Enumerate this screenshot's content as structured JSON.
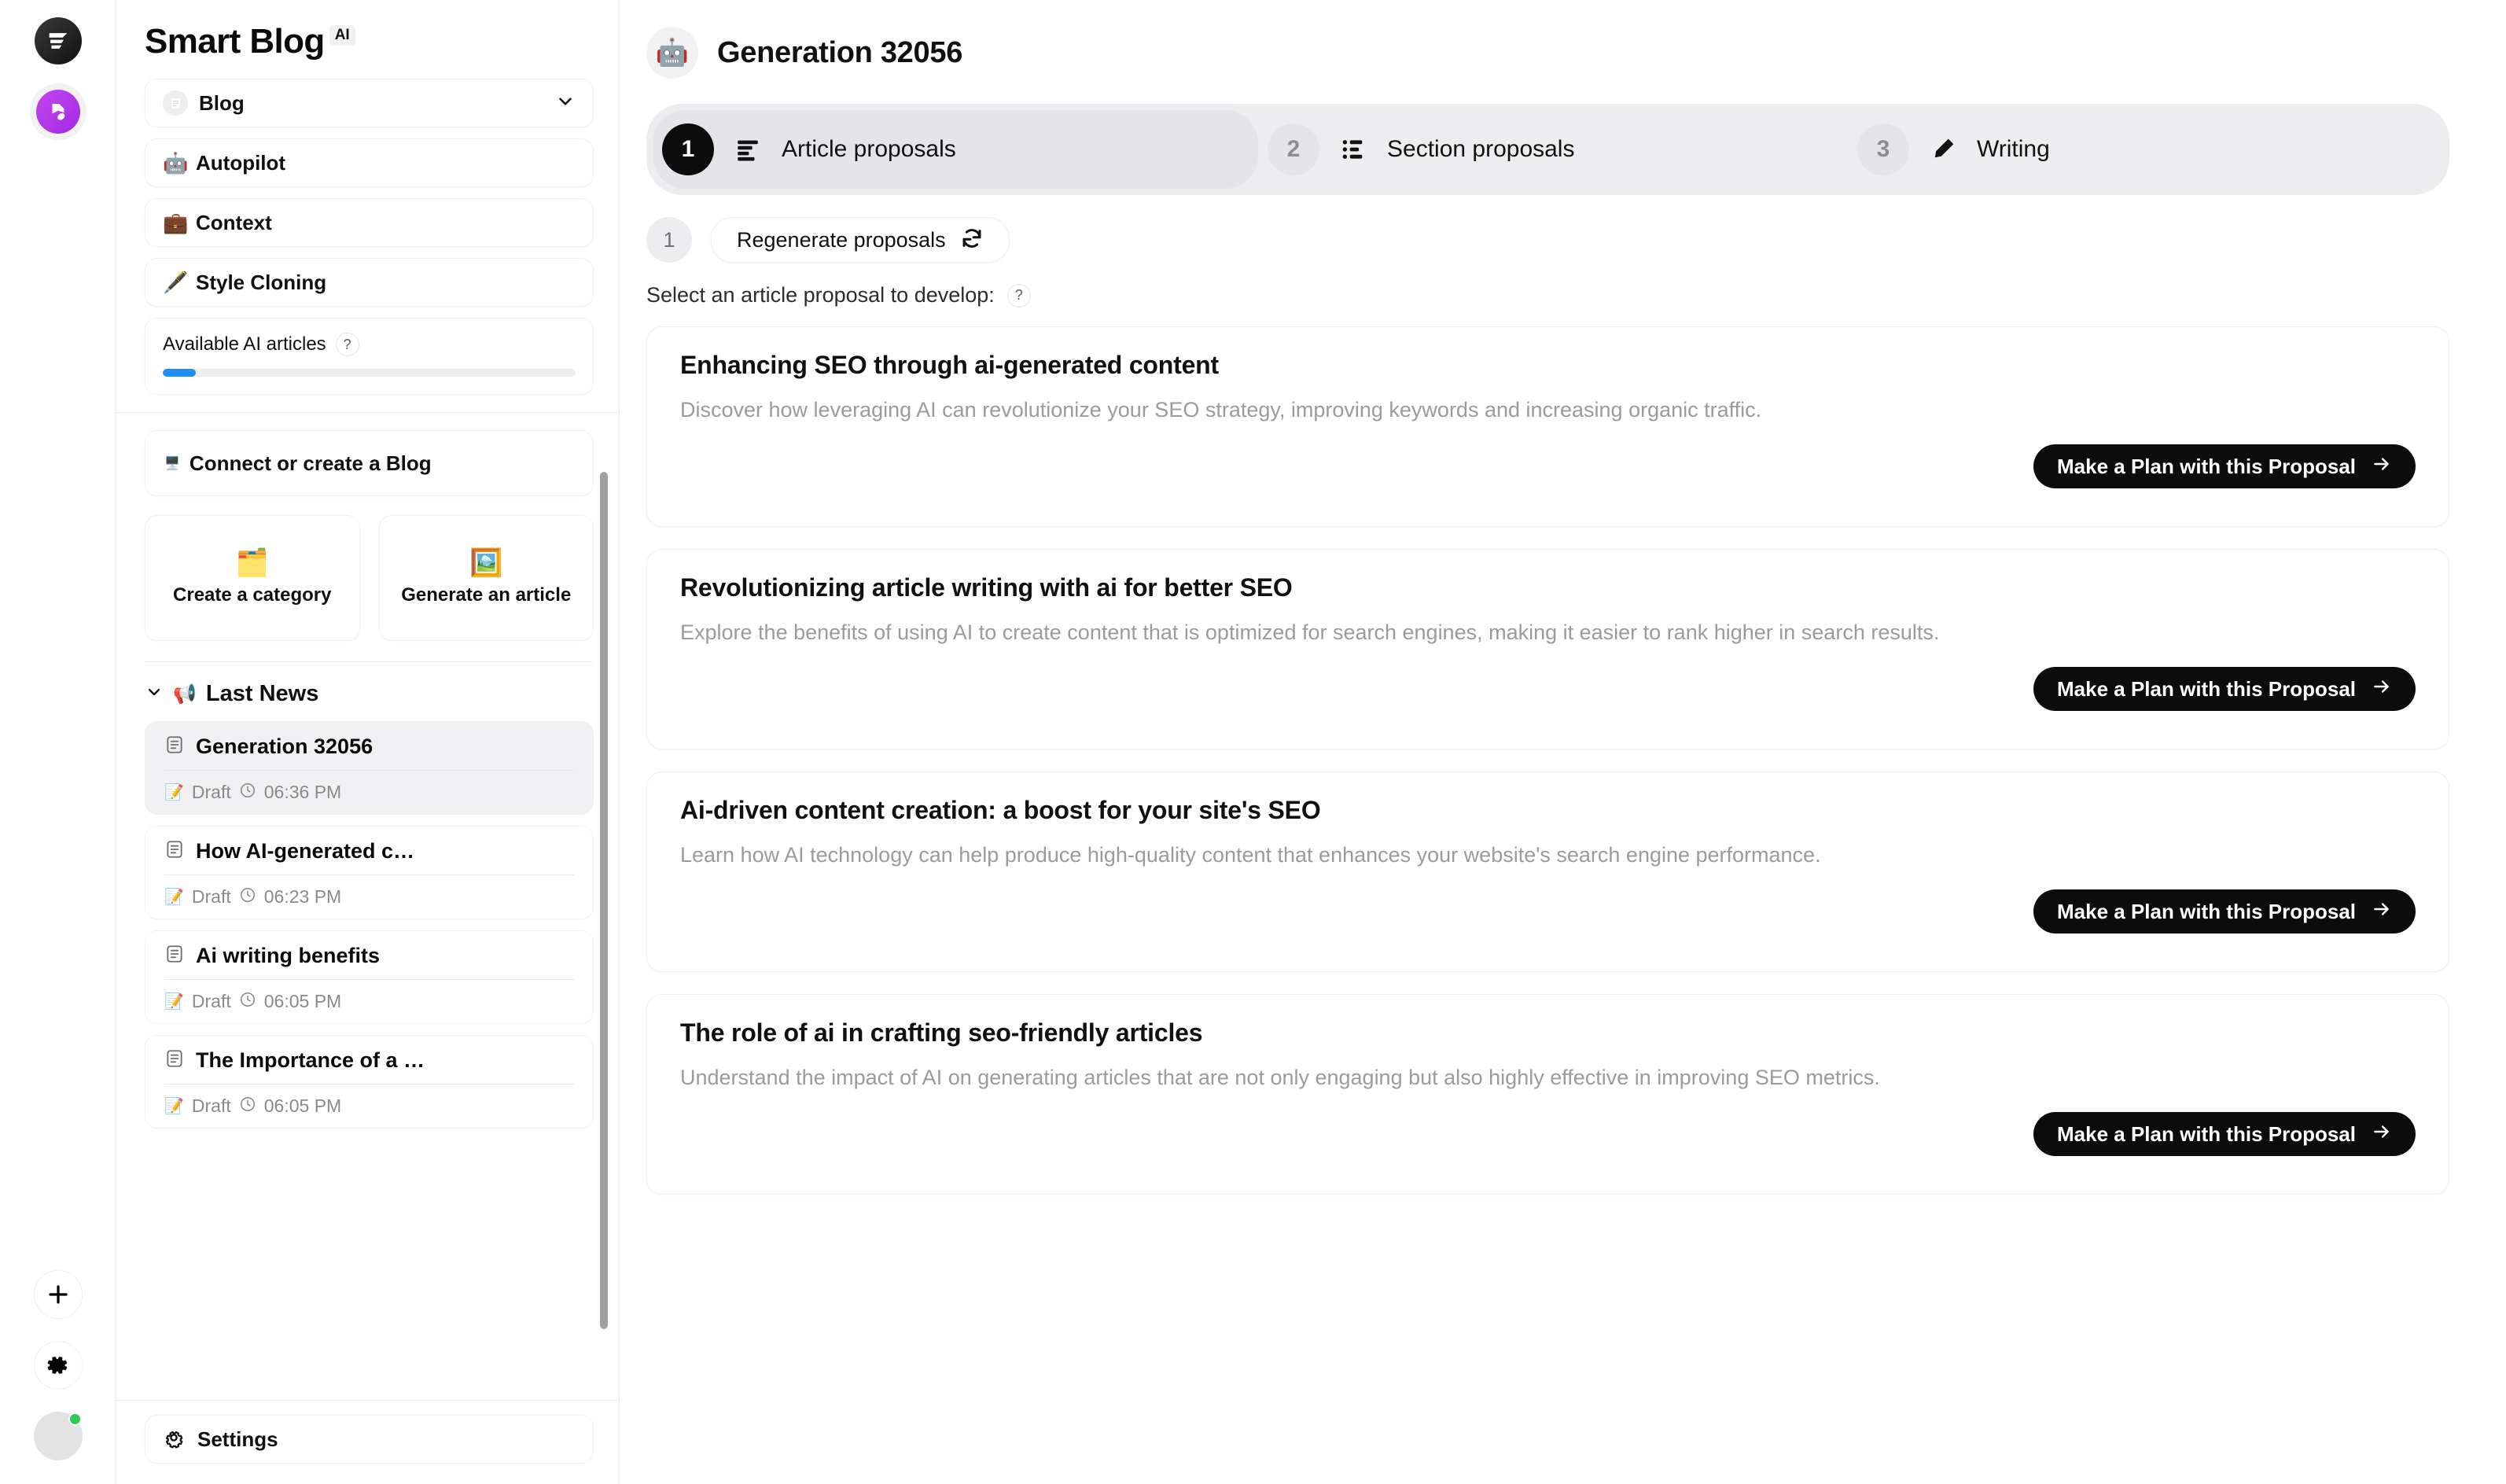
{
  "rail": {
    "logo_icon": "funnel-logo-icon",
    "avatar_icon": "workspace-avatar-icon",
    "add_label": "+",
    "gear_icon": "gear-icon",
    "user_status": "online"
  },
  "sidebar": {
    "title": "Smart Blog",
    "ai_badge": "AI",
    "nav": [
      {
        "label": "Blog",
        "icon": "document-circle-icon",
        "has_chevron": true
      },
      {
        "label": "Autopilot",
        "icon": "robot-emoji",
        "emoji": "🤖"
      },
      {
        "label": "Context",
        "icon": "briefcase-emoji",
        "emoji": "💼"
      },
      {
        "label": "Style Cloning",
        "icon": "fountain-pen-emoji",
        "emoji": "🖋️"
      }
    ],
    "quota": {
      "label": "Available AI articles",
      "help": "?",
      "percent": 8,
      "fill_color": "#1e90f5",
      "track_color": "#eeeeee"
    },
    "connect": {
      "label": "Connect or create a Blog",
      "emoji": "🖥️"
    },
    "tiles": [
      {
        "label": "Create a category",
        "emoji": "🗂️"
      },
      {
        "label": "Generate an article",
        "emoji": "🖼️"
      }
    ],
    "section": {
      "label": "Last News",
      "emoji": "📢",
      "expanded": true
    },
    "news": [
      {
        "title": "Generation 32056",
        "status": "Draft",
        "time": "06:36 PM",
        "active": true
      },
      {
        "title": "How AI-generated c…",
        "status": "Draft",
        "time": "06:23 PM",
        "active": false
      },
      {
        "title": "Ai writing benefits",
        "status": "Draft",
        "time": "06:05 PM",
        "active": false
      },
      {
        "title": "The Importance of a …",
        "status": "Draft",
        "time": "06:05 PM",
        "active": false
      }
    ],
    "settings_label": "Settings"
  },
  "main": {
    "generation_title": "Generation 32056",
    "generation_emoji": "🤖",
    "steps": [
      {
        "num": "1",
        "label": "Article proposals",
        "icon": "list-lines-icon",
        "active": true
      },
      {
        "num": "2",
        "label": "Section proposals",
        "icon": "list-bullets-icon",
        "active": false
      },
      {
        "num": "3",
        "label": "Writing",
        "icon": "pencil-icon",
        "active": false
      }
    ],
    "regenerate": {
      "num": "1",
      "label": "Regenerate proposals",
      "icon": "refresh-icon"
    },
    "select_prompt": "Select an article proposal to develop:",
    "select_help": "?",
    "cta_label": "Make a Plan with this Proposal",
    "proposals": [
      {
        "title": "Enhancing SEO through ai-generated content",
        "desc": "Discover how leveraging AI can revolutionize your SEO strategy, improving keywords and increasing organic traffic."
      },
      {
        "title": "Revolutionizing article writing with ai for better SEO",
        "desc": "Explore the benefits of using AI to create content that is optimized for search engines, making it easier to rank higher in search results."
      },
      {
        "title": "Ai-driven content creation: a boost for your site's SEO",
        "desc": "Learn how AI technology can help produce high-quality content that enhances your website's search engine performance."
      },
      {
        "title": "The role of ai in crafting seo-friendly articles",
        "desc": "Understand the impact of AI on generating articles that are not only engaging but also highly effective in improving SEO metrics."
      }
    ]
  }
}
